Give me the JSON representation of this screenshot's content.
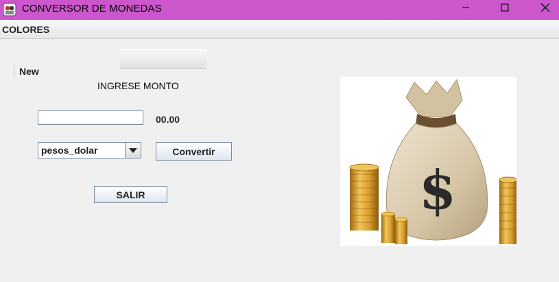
{
  "window": {
    "title": "CONVERSOR DE MONEDAS"
  },
  "menu": {
    "colores": "COLORES"
  },
  "form": {
    "new_label": "New",
    "prompt": "INGRESE MONTO",
    "amount_value": "",
    "result": "00.00",
    "conversion_selected": "pesos_dolar",
    "convert_button": "Convertir",
    "exit_button": "SALIR"
  },
  "image": {
    "symbol": "$"
  }
}
